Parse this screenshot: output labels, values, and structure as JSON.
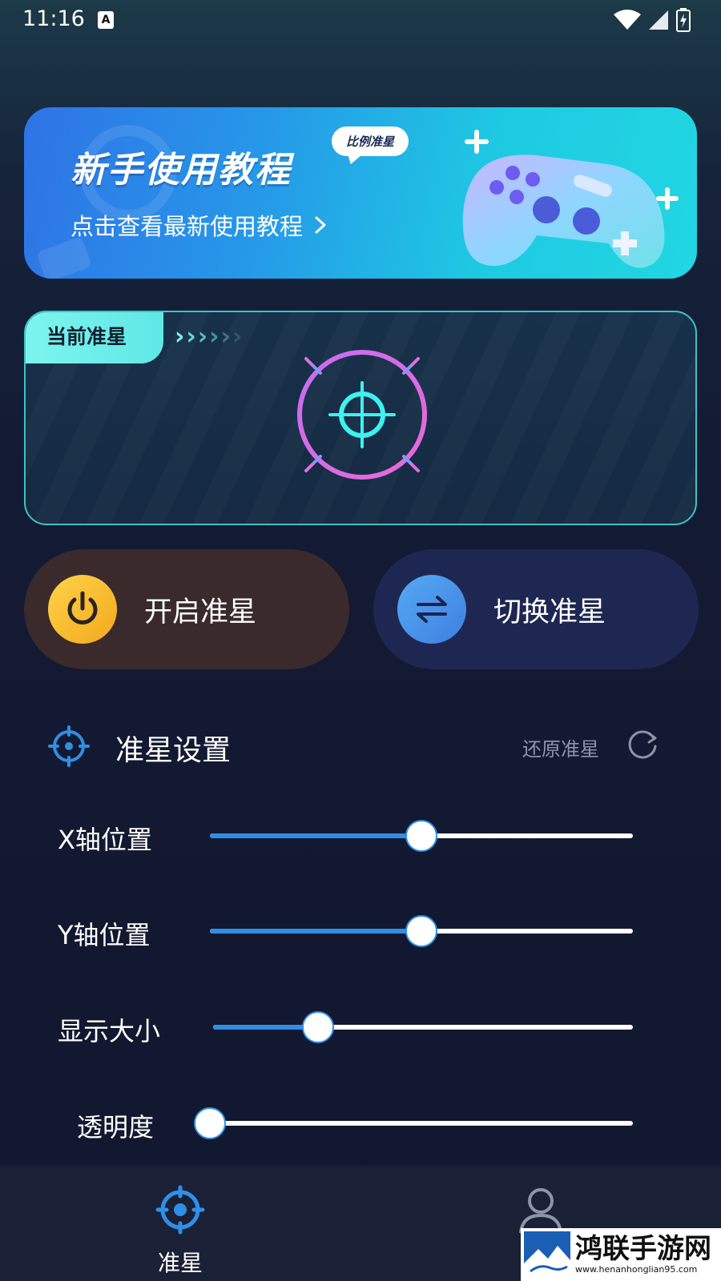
{
  "status_bar": {
    "time": "11:16",
    "notification_icon": "A",
    "icons": [
      "wifi-icon",
      "signal-icon",
      "battery-icon"
    ]
  },
  "banner": {
    "title": "新手使用教程",
    "tag": "比例准星",
    "subtitle": "点击查看最新使用教程"
  },
  "crosshair_panel": {
    "tab_label": "当前准星",
    "arrows": [
      "›",
      "›",
      "›",
      "›",
      "›",
      "›"
    ]
  },
  "actions": {
    "open_label": "开启准星",
    "switch_label": "切换准星"
  },
  "settings": {
    "title": "准星设置",
    "restore_label": "还原准星",
    "sliders": [
      {
        "label": "X轴位置",
        "value": 0.5
      },
      {
        "label": "Y轴位置",
        "value": 0.5
      },
      {
        "label": "显示大小",
        "value": 0.25
      },
      {
        "label": "透明度",
        "value": 0.0
      }
    ]
  },
  "bottom_nav": {
    "items": [
      {
        "label": "准星",
        "icon": "crosshair-icon",
        "active": true
      },
      {
        "label": "",
        "icon": "user-icon",
        "active": false
      }
    ]
  },
  "watermark": {
    "title": "鸿联手游网",
    "url": "www.henanhonglian95.com"
  },
  "colors": {
    "accent": "#2f8fe6",
    "teal": "#5fe8e6",
    "crosshair_ring": "#d96cf0",
    "crosshair_center": "#3ff0f0",
    "open_button_bg": "#3a2a2c",
    "switch_button_bg": "#1e2752"
  }
}
